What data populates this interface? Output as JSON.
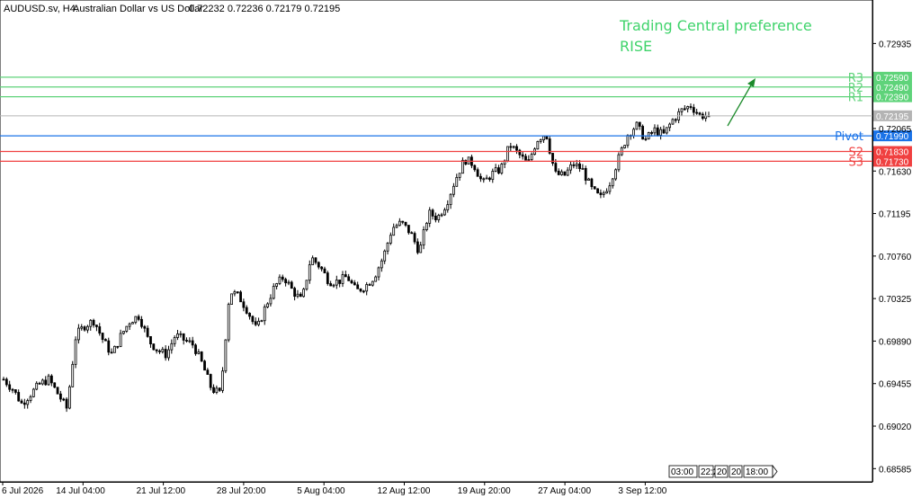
{
  "header": {
    "symbol": "AUDUSD.sv, H4:",
    "description": "Australian Dollar vs US Dollar",
    "ohlc": "0.72232 0.72236 0.72179 0.72195"
  },
  "preference": {
    "title": "Trading Central preference",
    "value": "RISE",
    "color": "#3ed36a"
  },
  "levels": [
    {
      "name": "R3",
      "value": "0.72590",
      "price": 0.7259,
      "color": "#5fd37a"
    },
    {
      "name": "R2",
      "value": "0.72490",
      "price": 0.7249,
      "color": "#5fd37a"
    },
    {
      "name": "R1",
      "value": "0.72390",
      "price": 0.7239,
      "color": "#5fd37a"
    },
    {
      "name": "Pivot",
      "value": "0.71990",
      "price": 0.7199,
      "color": "#1a73e8"
    },
    {
      "name": "S2",
      "value": "0.71830",
      "price": 0.7183,
      "color": "#f04040"
    },
    {
      "name": "S3",
      "value": "0.71730",
      "price": 0.7173,
      "color": "#f04040"
    }
  ],
  "current_price": {
    "value": "0.72195",
    "price": 0.72195,
    "color": "#b4b4b4"
  },
  "time_box": [
    "03:00",
    "22:20",
    "20",
    "20",
    "18:00"
  ],
  "chart_data": {
    "type": "candlestick",
    "title": "AUDUSD.sv, H4",
    "ylim": [
      0.6845,
      0.7338
    ],
    "yticks": [
      "0.72935",
      "0.72065",
      "0.71630",
      "0.71195",
      "0.70760",
      "0.70325",
      "0.69890",
      "0.69455",
      "0.69020",
      "0.68585"
    ],
    "xticks": [
      "6 Jul 2026",
      "14 Jul 04:00",
      "21 Jul 12:00",
      "28 Jul 20:00",
      "5 Aug 04:00",
      "12 Aug 12:00",
      "19 Aug 20:00",
      "27 Aug 04:00",
      "3 Sep 12:00"
    ],
    "series": [
      {
        "name": "AUDUSD.sv",
        "close_path": [
          0.695,
          0.694,
          0.6925,
          0.6935,
          0.6945,
          0.695,
          0.6935,
          0.692,
          0.6995,
          0.7005,
          0.701,
          0.699,
          0.6975,
          0.6995,
          0.701,
          0.7015,
          0.699,
          0.698,
          0.6975,
          0.6995,
          0.699,
          0.6985,
          0.6965,
          0.694,
          0.6935,
          0.704,
          0.7035,
          0.702,
          0.7,
          0.7025,
          0.7045,
          0.7055,
          0.704,
          0.703,
          0.7075,
          0.7065,
          0.705,
          0.705,
          0.7055,
          0.704,
          0.7045,
          0.7055,
          0.7075,
          0.7105,
          0.711,
          0.71,
          0.708,
          0.712,
          0.7115,
          0.713,
          0.7155,
          0.7175,
          0.717,
          0.715,
          0.716,
          0.7165,
          0.719,
          0.718,
          0.717,
          0.7195,
          0.7202,
          0.716,
          0.7158,
          0.717,
          0.7165,
          0.7145,
          0.7135,
          0.715,
          0.7175,
          0.72,
          0.721,
          0.7195,
          0.7205,
          0.72,
          0.7215,
          0.7225,
          0.723,
          0.722,
          0.72195
        ]
      }
    ]
  }
}
